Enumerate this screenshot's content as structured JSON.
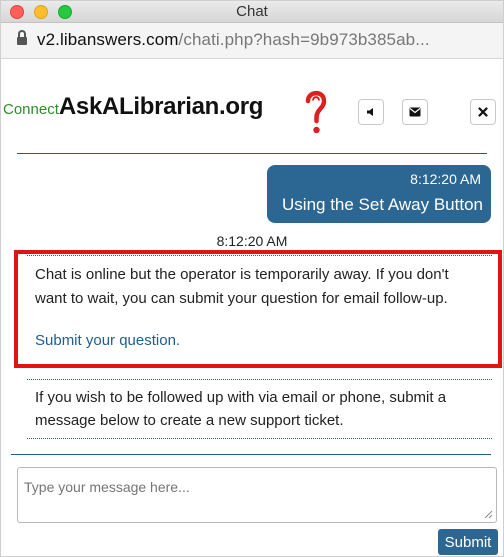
{
  "window": {
    "title": "Chat"
  },
  "address_bar": {
    "host": "v2.libanswers.com",
    "path": "/chati.php?hash=9b973b385ab..."
  },
  "header": {
    "logo_connect": "Connect",
    "logo_name": "AskALibrarian.org",
    "icons": [
      "lock-icon",
      "sound-icon",
      "mail-icon",
      "close-icon"
    ]
  },
  "chat": {
    "user_message": {
      "time": "8:12:20 AM",
      "text": "Using the Set Away Button"
    },
    "system_time": "8:12:20 AM",
    "away_notice": {
      "line1": "Chat is online but the operator is temporarily away. If you don't",
      "line2": "want to wait, you can submit your question for email follow-up.",
      "link": "Submit your question."
    },
    "ticket_notice": {
      "line1": "If you wish to be followed up with via email or phone, submit a",
      "line2": "message below to create a new support ticket."
    }
  },
  "composer": {
    "placeholder": "Type your message here...",
    "submit_label": "Submit"
  },
  "colors": {
    "accent": "#2b6792",
    "highlight": "#e11313",
    "logo_green": "#2e8b2e"
  }
}
